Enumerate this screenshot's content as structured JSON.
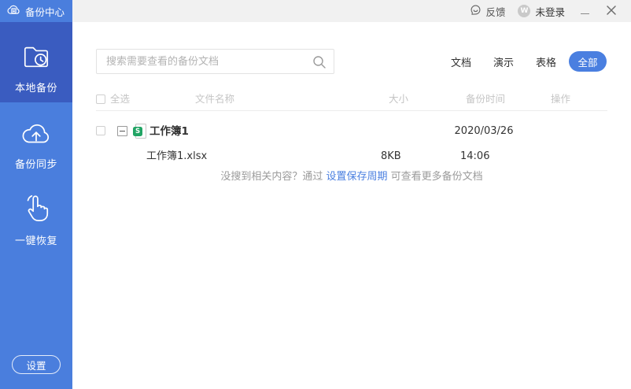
{
  "window": {
    "title": "备份中心",
    "feedback_label": "反馈",
    "avatar_letter": "W",
    "login_status": "未登录"
  },
  "sidebar": {
    "items": [
      {
        "label": "本地备份",
        "icon": "folder-clock-icon",
        "active": true
      },
      {
        "label": "备份同步",
        "icon": "cloud-upload-icon",
        "active": false
      },
      {
        "label": "一键恢复",
        "icon": "hand-click-icon",
        "active": false
      }
    ],
    "settings_label": "设置"
  },
  "toolbar": {
    "search_placeholder": "搜索需要查看的备份文档",
    "tabs": [
      {
        "label": "文档",
        "active": false
      },
      {
        "label": "演示",
        "active": false
      },
      {
        "label": "表格",
        "active": false
      },
      {
        "label": "全部",
        "active": true
      }
    ]
  },
  "table": {
    "select_all_label": "全选",
    "headers": {
      "name": "文件名称",
      "size": "大小",
      "time": "备份时间",
      "ops": "操作"
    },
    "groups": [
      {
        "name": "工作簿1",
        "date": "2020/03/26",
        "file_type_letter": "S",
        "files": [
          {
            "name": "工作簿1.xlsx",
            "size": "8KB",
            "time": "14:06"
          }
        ]
      }
    ]
  },
  "hint": {
    "prefix": "没搜到相关内容？通过 ",
    "link": "设置保存周期",
    "suffix": " 可查看更多备份文档"
  },
  "colors": {
    "sidebar": "#4a7edd",
    "sidebar_active": "#3a5cc0",
    "accent": "#4a7fe0",
    "topbar_bg": "#f1f1f1",
    "file_badge_green": "#21a464"
  }
}
